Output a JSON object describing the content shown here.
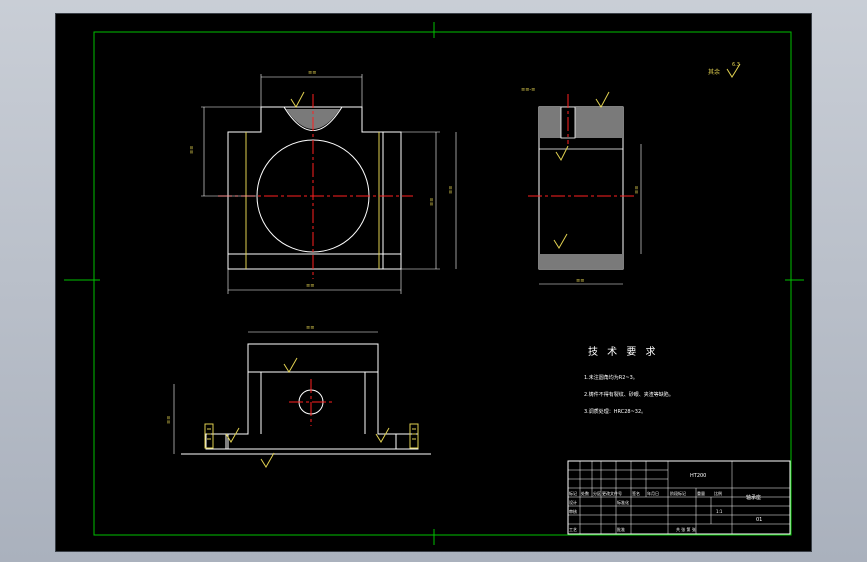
{
  "tech_req": {
    "title": "技 术 要 求",
    "items": [
      "1.未注圆角均为R2~3。",
      "2.铸件不得有裂纹、砂眼、夹渣等缺陷。",
      "3.调质处理：HRC28~32。"
    ]
  },
  "roughness_note": "其余",
  "roughness_value": "6.3",
  "title_block": {
    "row_labels": [
      "标记",
      "设计",
      "审核",
      "工艺"
    ],
    "header_labels": [
      "处数",
      "分区",
      "更改文件号",
      "签名",
      "年月日"
    ],
    "standardization": "标准化",
    "approve": "批准",
    "stage_mark": "阶段标记",
    "weight": "重量",
    "scale": "比例",
    "scale_value": "1:1",
    "sheet": "共 张 第 张",
    "material": "HT200",
    "part_name": "轴承座",
    "drawing_no": "01"
  }
}
